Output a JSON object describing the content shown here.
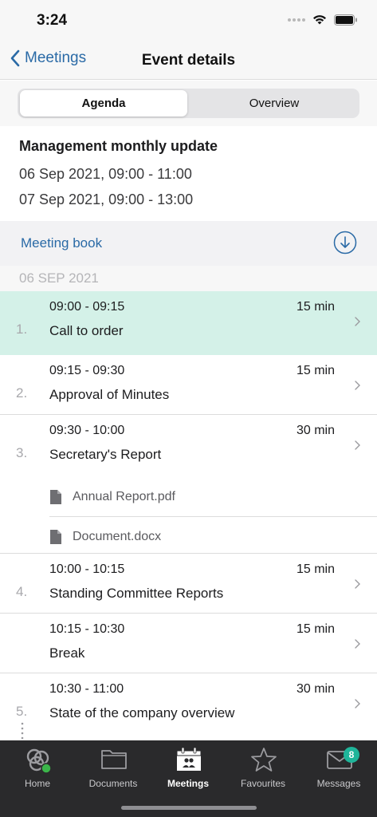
{
  "status": {
    "time": "3:24"
  },
  "nav": {
    "back_label": "Meetings",
    "title": "Event details"
  },
  "tabs": {
    "agenda": "Agenda",
    "overview": "Overview"
  },
  "event": {
    "title": "Management monthly update",
    "dates": [
      "06 Sep 2021, 09:00 - 11:00",
      "07 Sep 2021, 09:00 - 13:00"
    ]
  },
  "meeting_book": {
    "label": "Meeting book",
    "icon": "download-icon"
  },
  "day": {
    "label": "06 SEP 2021"
  },
  "agenda": [
    {
      "number": "1.",
      "time": "09:00 - 09:15",
      "duration": "15 min",
      "title": "Call to order",
      "current": true
    },
    {
      "number": "2.",
      "time": "09:15 - 09:30",
      "duration": "15 min",
      "title": "Approval of Minutes"
    },
    {
      "number": "3.",
      "time": "09:30 - 10:00",
      "duration": "30 min",
      "title": "Secretary's Report",
      "attachments": [
        "Annual Report.pdf",
        "Document.docx"
      ]
    },
    {
      "number": "4.",
      "time": "10:00 - 10:15",
      "duration": "15 min",
      "title": "Standing Committee Reports"
    },
    {
      "number": "",
      "time": "10:15 - 10:30",
      "duration": "15 min",
      "title": "Break"
    },
    {
      "number": "5.",
      "time": "10:30 - 11:00",
      "duration": "30 min",
      "title": "State of the company overview"
    }
  ],
  "tab_bar": {
    "home": "Home",
    "documents": "Documents",
    "meetings": "Meetings",
    "favourites": "Favourites",
    "messages": "Messages",
    "messages_badge": "8"
  },
  "colors": {
    "accent": "#2a6aa6",
    "current_item": "#d4f1e8",
    "badge": "#1fb59a",
    "tab_bar": "#2a2a2c"
  }
}
